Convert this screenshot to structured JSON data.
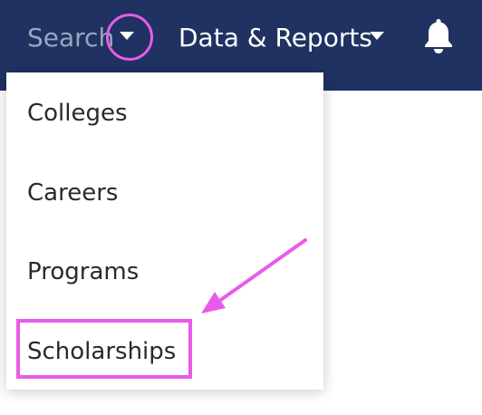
{
  "nav": {
    "search_label": "Search",
    "data_reports_label": "Data & Reports",
    "search_caret_icon": "caret-down-icon",
    "data_caret_icon": "caret-down-icon",
    "bell_icon": "bell-icon",
    "bg_color": "#1f3261"
  },
  "dropdown": {
    "items": [
      {
        "label": "Colleges"
      },
      {
        "label": "Careers"
      },
      {
        "label": "Programs"
      },
      {
        "label": "Scholarships"
      }
    ]
  },
  "annotations": {
    "highlight_color": "#e85ce8"
  }
}
